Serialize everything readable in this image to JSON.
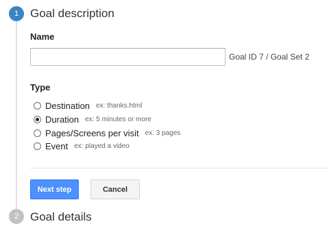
{
  "steps": [
    {
      "number": "1",
      "title": "Goal description"
    },
    {
      "number": "2",
      "title": "Goal details"
    }
  ],
  "name_section": {
    "label": "Name",
    "input_value": "",
    "input_placeholder": "",
    "goal_id_text": "Goal ID 7 / Goal Set 2"
  },
  "type_section": {
    "label": "Type",
    "selected": "Duration",
    "options": [
      {
        "label": "Destination",
        "hint": "ex: thanks.html",
        "checked": false
      },
      {
        "label": "Duration",
        "hint": "ex: 5 minutes or more",
        "checked": true
      },
      {
        "label": "Pages/Screens per visit",
        "hint": "ex: 3 pages",
        "checked": false
      },
      {
        "label": "Event",
        "hint": "ex: played a video",
        "checked": false
      }
    ]
  },
  "buttons": {
    "next_label": "Next step",
    "cancel_label": "Cancel"
  },
  "colors": {
    "active_step": "#3b84c4",
    "inactive_step": "#c2c2c2",
    "primary_button": "#4d90fe"
  }
}
